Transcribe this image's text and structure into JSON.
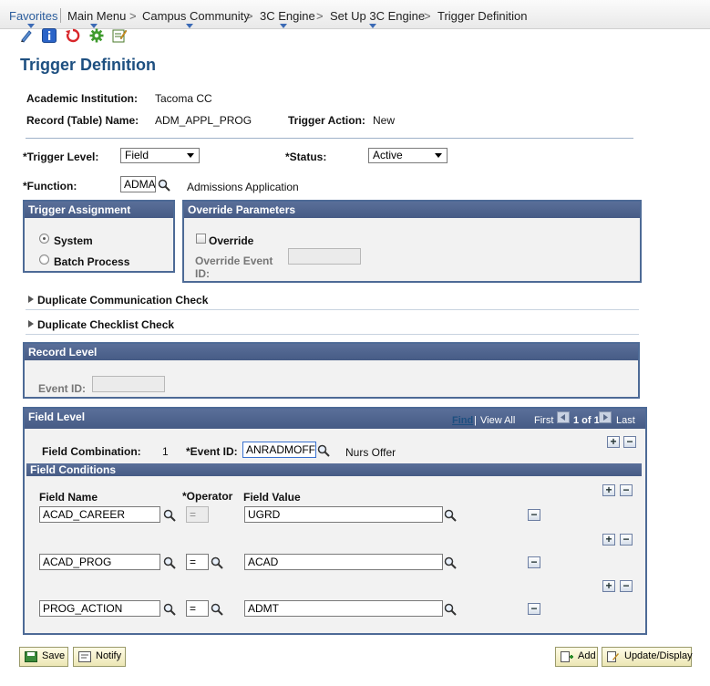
{
  "breadcrumb": {
    "favorites": "Favorites",
    "main_menu": "Main Menu",
    "campus_community": "Campus Community",
    "engine": "3C Engine",
    "setup": "Set Up 3C Engine",
    "current": "Trigger Definition",
    "separator": ">"
  },
  "toolbar_icons": [
    "help-icon",
    "info-icon",
    "refresh-icon",
    "settings-icon",
    "edit-icon"
  ],
  "page_title": "Trigger Definition",
  "header": {
    "institution_label": "Academic Institution:",
    "institution_value": "Tacoma CC",
    "record_label": "Record (Table) Name:",
    "record_value": "ADM_APPL_PROG",
    "action_label": "Trigger Action:",
    "action_value": "New"
  },
  "form": {
    "trigger_level_label": "*Trigger Level:",
    "trigger_level_value": "Field",
    "status_label": "*Status:",
    "status_value": "Active",
    "function_label": "*Function:",
    "function_value": "ADMA",
    "function_desc": "Admissions Application"
  },
  "trigger_assignment": {
    "title": "Trigger Assignment",
    "system_label": "System",
    "batch_label": "Batch Process",
    "selected": "System"
  },
  "override": {
    "title": "Override Parameters",
    "override_label": "Override",
    "event_label_1": "Override Event",
    "event_label_2": "ID:",
    "checked": false
  },
  "collapsibles": {
    "comm_check": "Duplicate Communication Check",
    "checklist_check": "Duplicate Checklist Check"
  },
  "record_level": {
    "title": "Record Level",
    "event_label": "Event ID:"
  },
  "field_level": {
    "title": "Field Level",
    "find": "Find",
    "view_all": "View All",
    "first": "First",
    "count": "1 of 1",
    "last": "Last",
    "combination_label": "Field Combination:",
    "combination_value": "1",
    "event_label": "*Event ID:",
    "event_value": "ANRADMOFF",
    "event_desc": "Nurs Offer",
    "conditions_title": "Field Conditions",
    "col_field_name": "Field Name",
    "col_operator": "*Operator",
    "col_field_value": "Field Value",
    "rows": [
      {
        "field_name": "ACAD_CAREER",
        "operator": "=",
        "field_value": "UGRD"
      },
      {
        "field_name": "ACAD_PROG",
        "operator": "=",
        "field_value": "ACAD"
      },
      {
        "field_name": "PROG_ACTION",
        "operator": "=",
        "field_value": "ADMT"
      }
    ]
  },
  "buttons": {
    "save": "Save",
    "notify": "Notify",
    "add": "Add",
    "update_display": "Update/Display"
  },
  "colors": {
    "title_blue": "#1d4f80",
    "panel_header": "#4d6a96",
    "button_face": "#fffce6"
  }
}
